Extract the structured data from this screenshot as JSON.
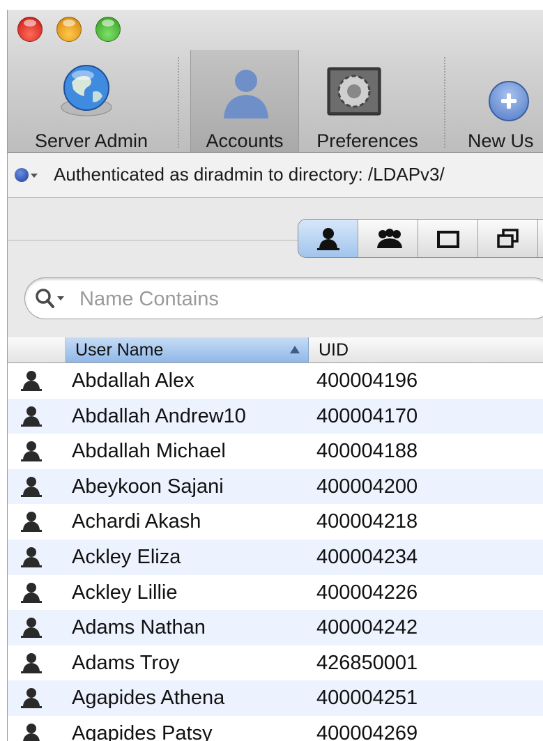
{
  "toolbar": {
    "items": [
      {
        "label": "Server Admin",
        "icon": "globe-icon"
      },
      {
        "label": "Accounts",
        "icon": "person-icon",
        "selected": true
      },
      {
        "label": "Preferences",
        "icon": "gear-icon"
      },
      {
        "label": "New Us",
        "icon": "plus-icon"
      }
    ]
  },
  "auth": {
    "text": "Authenticated as diradmin to directory: /LDAPv3/"
  },
  "account_type_tabs": [
    {
      "icon": "user-icon",
      "selected": true
    },
    {
      "icon": "group-icon"
    },
    {
      "icon": "computer-icon"
    },
    {
      "icon": "computer-group-icon"
    }
  ],
  "search": {
    "placeholder": "Name Contains",
    "value": ""
  },
  "table": {
    "columns": [
      "User Name",
      "UID"
    ],
    "sort_column": "User Name",
    "sort_direction": "ascending",
    "rows": [
      {
        "name": "Abdallah Alex",
        "uid": "400004196"
      },
      {
        "name": "Abdallah Andrew10",
        "uid": "400004170"
      },
      {
        "name": "Abdallah Michael",
        "uid": "400004188"
      },
      {
        "name": "Abeykoon Sajani",
        "uid": "400004200"
      },
      {
        "name": "Achardi Akash",
        "uid": "400004218"
      },
      {
        "name": "Ackley Eliza",
        "uid": "400004234"
      },
      {
        "name": "Ackley Lillie",
        "uid": "400004226"
      },
      {
        "name": "Adams Nathan",
        "uid": "400004242"
      },
      {
        "name": "Adams Troy",
        "uid": "426850001"
      },
      {
        "name": "Agapides Athena",
        "uid": "400004251"
      },
      {
        "name": "Agapides Patsy",
        "uid": "400004269"
      }
    ]
  },
  "colors": {
    "selection_blue": "#8fb8e8",
    "alt_row": "#edf3fe"
  }
}
